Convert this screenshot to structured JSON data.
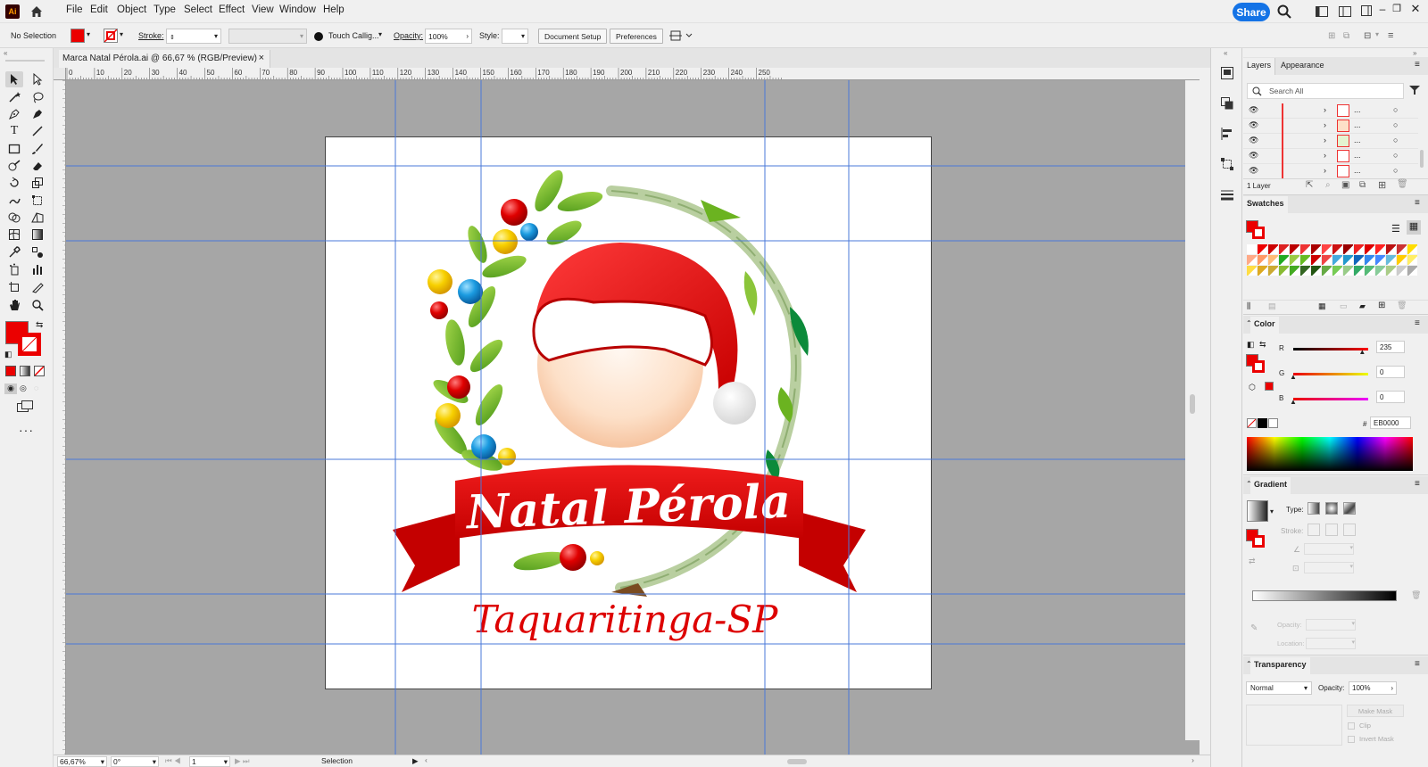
{
  "menubar": {
    "logo": "Ai",
    "items": [
      "File",
      "Edit",
      "Object",
      "Type",
      "Select",
      "Effect",
      "View",
      "Window",
      "Help"
    ],
    "share": "Share"
  },
  "controlbar": {
    "selection": "No Selection",
    "stroke_label": "Stroke:",
    "brush": "Touch Callig...",
    "opacity_label": "Opacity:",
    "opacity_value": "100%",
    "style_label": "Style:",
    "document_setup": "Document Setup",
    "preferences": "Preferences"
  },
  "document": {
    "tab_title": "Marca Natal Pérola.ai @ 66,67 % (RGB/Preview)",
    "tab_close": "×"
  },
  "ruler": {
    "h_labels": [
      "0",
      "10",
      "20",
      "30",
      "40",
      "50",
      "60",
      "70",
      "80",
      "90",
      "100",
      "110",
      "120",
      "130",
      "140",
      "150",
      "160",
      "170",
      "180",
      "190",
      "200",
      "210",
      "220",
      "230",
      "240",
      "250"
    ]
  },
  "artwork": {
    "title": "Natal Pérola",
    "subtitle": "Taquaritinga-SP"
  },
  "statusbar": {
    "zoom": "66,67%",
    "rotation": "0°",
    "artboard_num": "1",
    "tool": "Selection"
  },
  "layers_panel": {
    "tabs": [
      "Layers",
      "Appearance"
    ],
    "search_placeholder": "Search All",
    "rows": [
      "...",
      "...",
      "...",
      "...",
      "..."
    ],
    "count": "1 Layer"
  },
  "swatches_panel": {
    "title": "Swatches"
  },
  "color_panel": {
    "title": "Color",
    "r_label": "R",
    "r_value": "235",
    "g_label": "G",
    "g_value": "0",
    "b_label": "B",
    "b_value": "0",
    "hex_label": "#",
    "hex_value": "EB0000",
    "fill_color": "#eb0000"
  },
  "gradient_panel": {
    "title": "Gradient",
    "type_label": "Type:",
    "stroke_label": "Stroke:",
    "opacity_label": "Opacity:",
    "location_label": "Location:"
  },
  "transparency_panel": {
    "title": "Transparency",
    "blend_mode": "Normal",
    "opacity_label": "Opacity:",
    "opacity_value": "100%",
    "make_mask": "Make Mask",
    "clip": "Clip",
    "invert_mask": "Invert Mask"
  }
}
